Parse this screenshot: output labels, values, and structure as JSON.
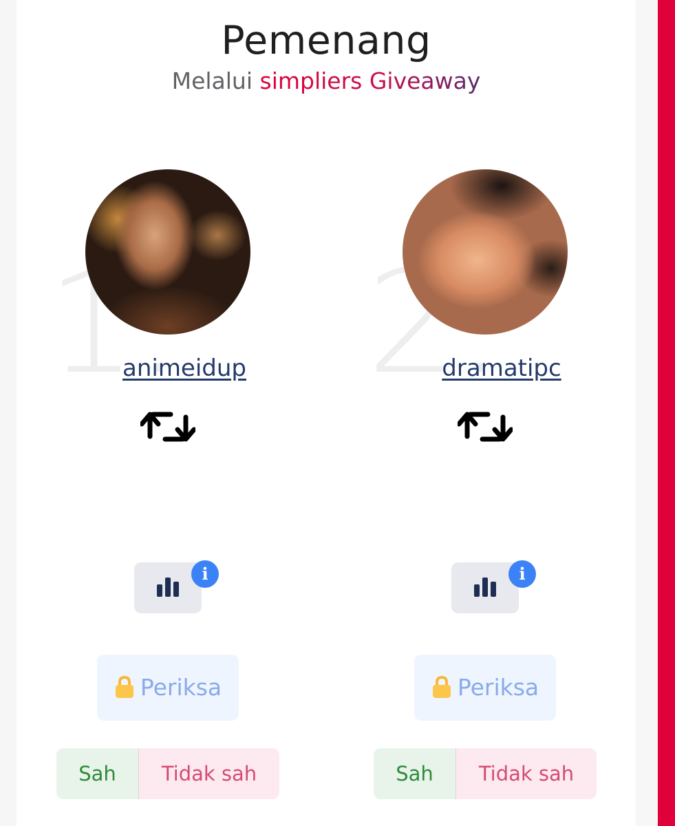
{
  "header": {
    "title": "Pemenang",
    "subtitle_prefix": "Melalui",
    "subtitle_brand": "simpliers Giveaway"
  },
  "winners": [
    {
      "rank": "1.",
      "username": "animeidup",
      "action_icon": "retweet-icon",
      "stats_icon": "bar-chart-icon",
      "info_badge": "i",
      "check_label": "Periksa",
      "check_icon": "lock-icon",
      "valid_label": "Sah",
      "invalid_label": "Tidak sah"
    },
    {
      "rank": "2.",
      "username": "dramatipc",
      "action_icon": "retweet-icon",
      "stats_icon": "bar-chart-icon",
      "info_badge": "i",
      "check_label": "Periksa",
      "check_icon": "lock-icon",
      "valid_label": "Sah",
      "invalid_label": "Tidak sah"
    }
  ],
  "colors": {
    "accent_red": "#e0003a",
    "username": "#243a6b",
    "info_badge": "#3b82f6",
    "valid_text": "#2f8a3b",
    "invalid_text": "#d64b72",
    "check_text": "#88abea"
  }
}
